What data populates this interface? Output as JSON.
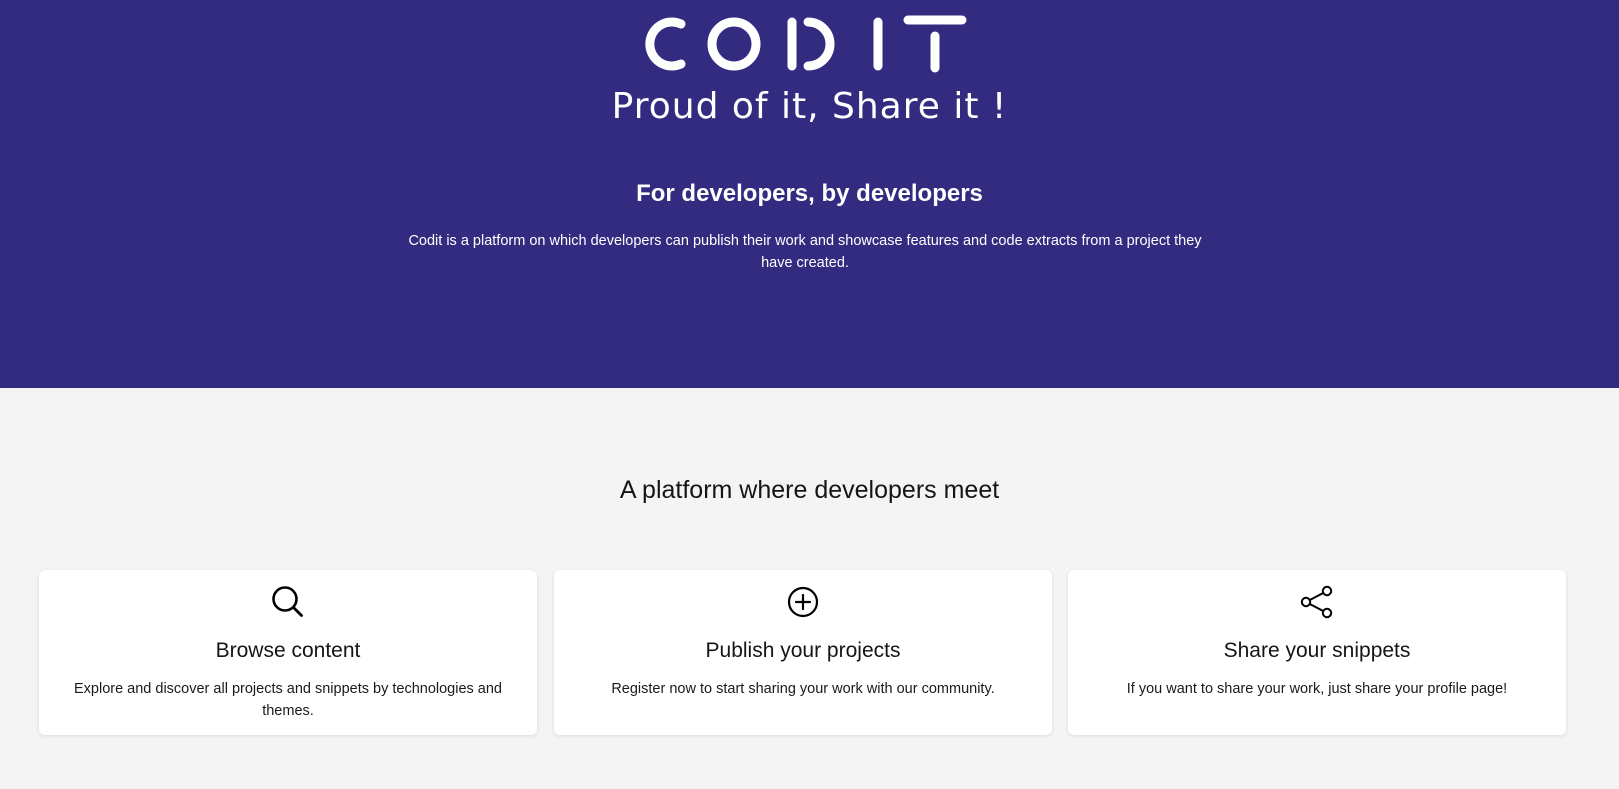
{
  "hero": {
    "logo_text": "CODIT",
    "tagline": "Proud of it, Share it !",
    "heading": "For developers, by developers",
    "description": "Codit is a platform on which developers can publish their work and showcase features and code extracts from a project they have created."
  },
  "features": {
    "title": "A platform where developers meet",
    "cards": [
      {
        "icon": "search-icon",
        "title": "Browse content",
        "text": "Explore and discover all projects and snippets by technologies and themes."
      },
      {
        "icon": "plus-circle-icon",
        "title": "Publish your projects",
        "text": "Register now to start sharing your work with our community."
      },
      {
        "icon": "share-icon",
        "title": "Share your snippets",
        "text": "If you want to share your work, just share your profile page!"
      }
    ]
  },
  "colors": {
    "hero_background": "#322b80",
    "page_background": "#f4f4f4",
    "card_background": "#ffffff"
  }
}
